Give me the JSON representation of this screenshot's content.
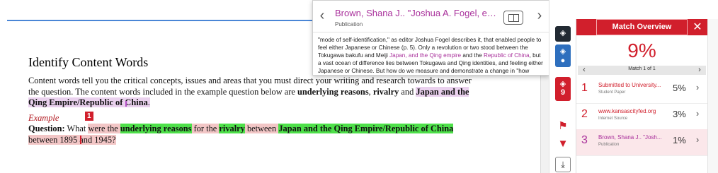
{
  "document": {
    "title": "Identify Content Words",
    "para_1": "Content words tell you the critical concepts, issues and areas that you must direct your writing and research towards to answer the question. The content words included in the example question below are ",
    "bold_reasons": "underlying reasons",
    "sep_1": ", ",
    "bold_rivalry": "rivalry",
    "sep_2": " and ",
    "bold_japan": "Japan and the Qing Empire/Republic of China",
    "end_dot": ".",
    "example_label": "Example",
    "question_label": "Question:",
    "q_pre": " What ",
    "q_were": "were the ",
    "q_reasons": "underlying reasons",
    "q_for": " for the ",
    "q_rivalry": "rivalry",
    "q_between": " between ",
    "q_japan": "Japan and the Qing Empire/Republic of China",
    "q_between2": " between 1895 and 1945",
    "q_end": "?",
    "marker_1": "1",
    "marker_3": "3"
  },
  "popup": {
    "title": "Brown, Shana J.. \"Joshua A. Fogel, editor. The...",
    "subtitle": "Publication",
    "body_1": "\"mode of self-identification,\" as editor Joshua Fogel describes it, that enabled people to feel either Japanese or Chinese (p. 5). Only a revolution or two stood between the Tokugawa bakufu and Meiji ",
    "body_hl_1": "Japan, and the Qing empire",
    "body_2": " and the ",
    "body_hl_2": "Republic of China",
    "body_3": ", but a vast ocean of difference lies between Tokugawa and Qing identities, and feeling either Japanese or Chinese. But how do we measure and demonstrate a change in \"how individuals see"
  },
  "toolbar": {
    "match_count": "9"
  },
  "panel": {
    "title": "Match Overview",
    "percent": "9%",
    "nav_label": "Match 1 of 1",
    "matches": [
      {
        "num": "1",
        "title": "Submitted to University...",
        "type": "Student Paper",
        "pct": "5%",
        "color": "#d11f2c"
      },
      {
        "num": "2",
        "title": "www.kansascityfed.org",
        "type": "Internet Source",
        "pct": "3%",
        "color": "#d11f2c"
      },
      {
        "num": "3",
        "title": "Brown, Shana J.. \"Josh...",
        "type": "Publication",
        "pct": "1%",
        "color": "#a9309b"
      }
    ]
  },
  "colors": {
    "accent_red": "#d11f2c",
    "publication_purple": "#a9309b",
    "highlight_green": "#4ee04a",
    "highlight_pink": "#f2c6c6"
  }
}
